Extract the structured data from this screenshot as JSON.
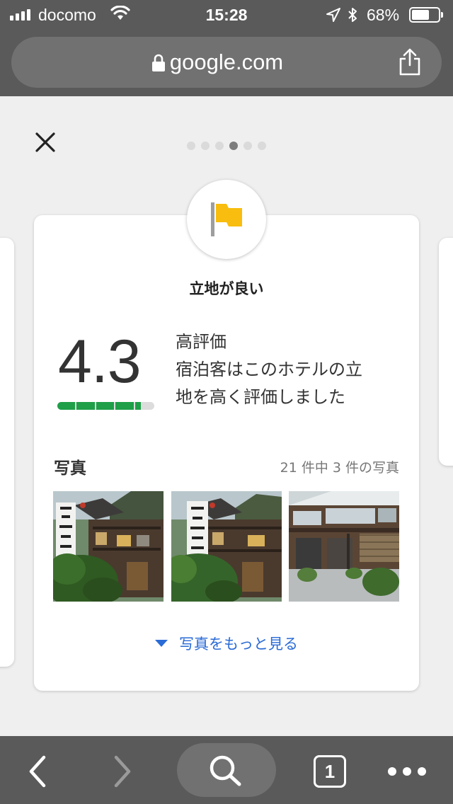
{
  "status_bar": {
    "carrier": "docomo",
    "time": "15:28",
    "battery_percent": "68%",
    "battery_level": 0.68
  },
  "browser": {
    "url": "google.com"
  },
  "carousel": {
    "page_count": 6,
    "active_index": 3
  },
  "card": {
    "category": "立地が良い",
    "score": "4.3",
    "score_value": 4.3,
    "score_max": 5,
    "rating_label": "高評価",
    "rating_description": "宿泊客はこのホテルの立地を高く評価しました",
    "photos_title": "写真",
    "photos_count": "21 件中 3 件の写真",
    "more_photos": "写真をもっと見る"
  },
  "toolbar": {
    "tab_count": "1"
  },
  "colors": {
    "flag": "#f8bd0e",
    "score_bar": "#1e9f48",
    "link": "#2a6bd6",
    "chrome": "#5a5a5a"
  },
  "icons": [
    "signal-icon",
    "wifi-icon",
    "location-icon",
    "bluetooth-icon",
    "battery-icon",
    "lock-icon",
    "share-icon",
    "close-icon",
    "flag-icon",
    "back-icon",
    "forward-icon",
    "search-icon",
    "tabs-icon",
    "more-icon"
  ]
}
